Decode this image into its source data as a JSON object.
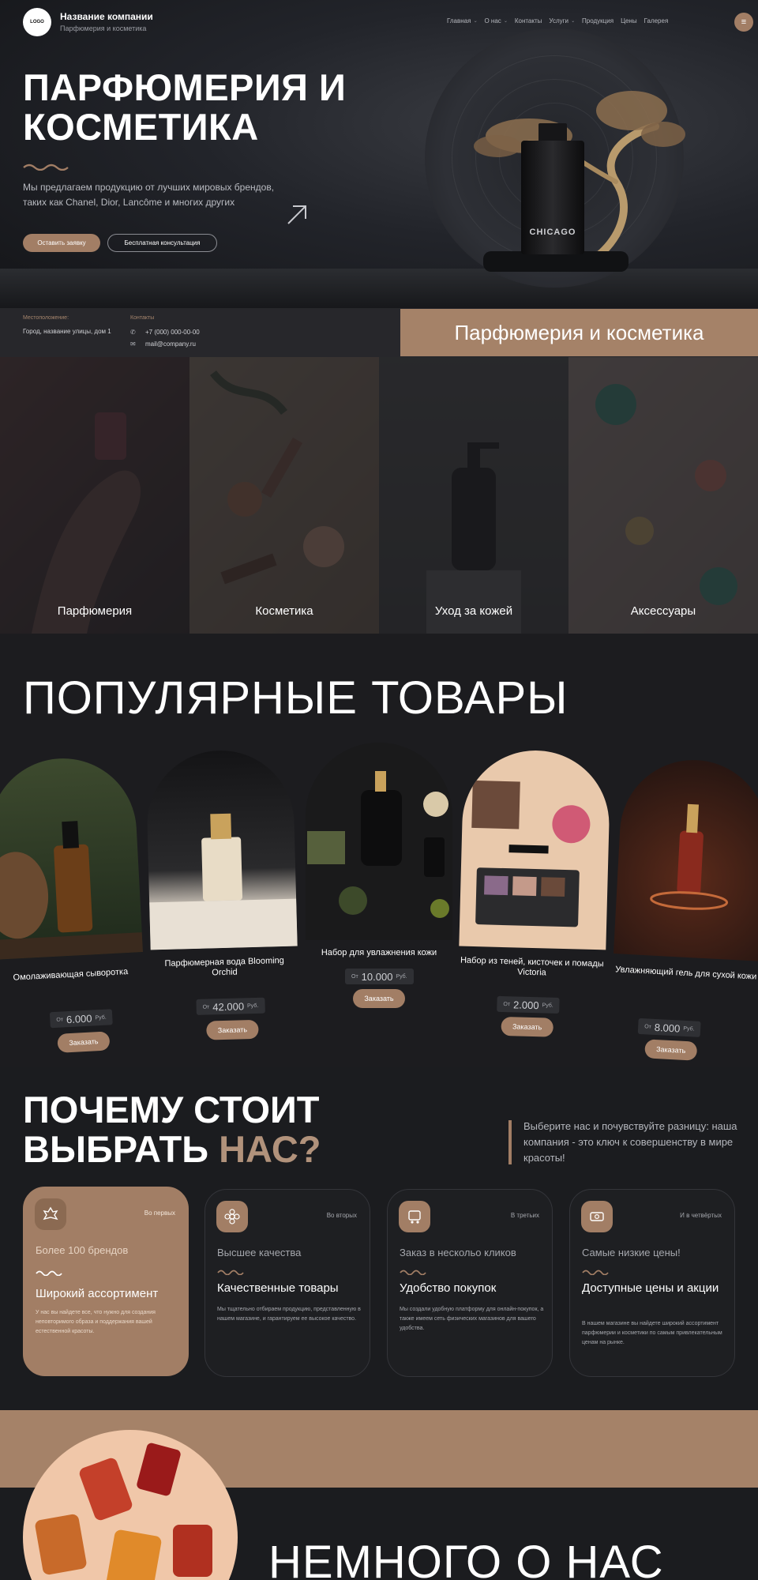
{
  "header": {
    "logo": "LOGO",
    "company_name": "Название компании",
    "company_sub": "Парфюмерия и косметика",
    "nav": [
      {
        "label": "Главная",
        "dropdown": true
      },
      {
        "label": "О нас",
        "dropdown": true
      },
      {
        "label": "Контакты",
        "dropdown": false
      },
      {
        "label": "Услуги",
        "dropdown": true
      },
      {
        "label": "Продукция",
        "dropdown": false
      },
      {
        "label": "Цены",
        "dropdown": false
      },
      {
        "label": "Галерея",
        "dropdown": false
      }
    ],
    "menu_icon": "menu-icon"
  },
  "hero": {
    "title": "ПАРФЮМЕРИЯ И КОСМЕТИКА",
    "description": "Мы предлагаем продукцию от лучших мировых брендов, таких как Chanel, Dior, Lancôme и многих других",
    "order_button": "Оставить заявку",
    "consult_button": "Бесплатная консультация",
    "bottle_label": "CHICAGO"
  },
  "info": {
    "location_label": "Местоположение:",
    "location_value": "Город, название улицы, дом 1",
    "contacts_label": "Контакты",
    "phone": "+7 (000) 000-00-00",
    "email": "mail@company.ru",
    "banner": "Парфюмерия и косметика"
  },
  "categories": [
    {
      "label": "Парфюмерия"
    },
    {
      "label": "Косметика"
    },
    {
      "label": "Уход за кожей"
    },
    {
      "label": "Аксессуары"
    }
  ],
  "popular": {
    "title": "ПОПУЛЯРНЫЕ ТОВАРЫ",
    "from": "От",
    "currency": "Руб.",
    "order_label": "Заказать",
    "items": [
      {
        "name": "Омолаживающая сыворотка",
        "price": "6.000"
      },
      {
        "name": "Парфюмерная вода Blooming Orchid",
        "price": "42.000"
      },
      {
        "name": "Набор для увлажнения кожи",
        "price": "10.000"
      },
      {
        "name": "Набор из теней, кисточек и помады Victoria",
        "price": "2.000"
      },
      {
        "name": "Увлажняющий гель для сухой кожи",
        "price": "8.000"
      }
    ]
  },
  "why": {
    "title_line1": "ПОЧЕМУ СТОИТ",
    "title_line2": "ВЫБРАТЬ ",
    "title_accent": "НАС?",
    "text": "Выберите нас и почувствуйте разницу: наша компания - это ключ к совершенству в мире красоты!",
    "cards": [
      {
        "order": "Во первых",
        "sub": "Более 100 брендов",
        "head": "Широкий ассортимент",
        "desc": "У нас вы найдете все, что нужно для создания неповторимого образа и поддержания вашей естественной красоты.",
        "icon": "crest-icon"
      },
      {
        "order": "Во вторых",
        "sub": "Высшее качества",
        "head": "Качественные товары",
        "desc": "Мы тщательно отбираем продукцию, представленную в нашем магазине, и гарантируем ее высокое качество.",
        "icon": "flower-icon"
      },
      {
        "order": "В третьих",
        "sub": "Заказ в нескольо кликов",
        "head": "Удобство покупок",
        "desc": "Мы создали удобную платформу для онлайн-покупок, а также имеем сеть физических магазинов для вашего удобства.",
        "icon": "cart-icon"
      },
      {
        "order": "И в четвёртых",
        "sub": "Самые низкие цены!",
        "head": "Доступные цены и акции",
        "desc": "В нашем магазине вы найдете широкий ассортимент парфюмерии и косметики по самым привлекательным ценам на рынке.",
        "icon": "tag-icon"
      }
    ]
  },
  "about": {
    "title": "НЕМНОГО О НАС"
  },
  "colors": {
    "accent": "#a27e65",
    "background": "#1b1c1f",
    "banner": "#a58268"
  }
}
